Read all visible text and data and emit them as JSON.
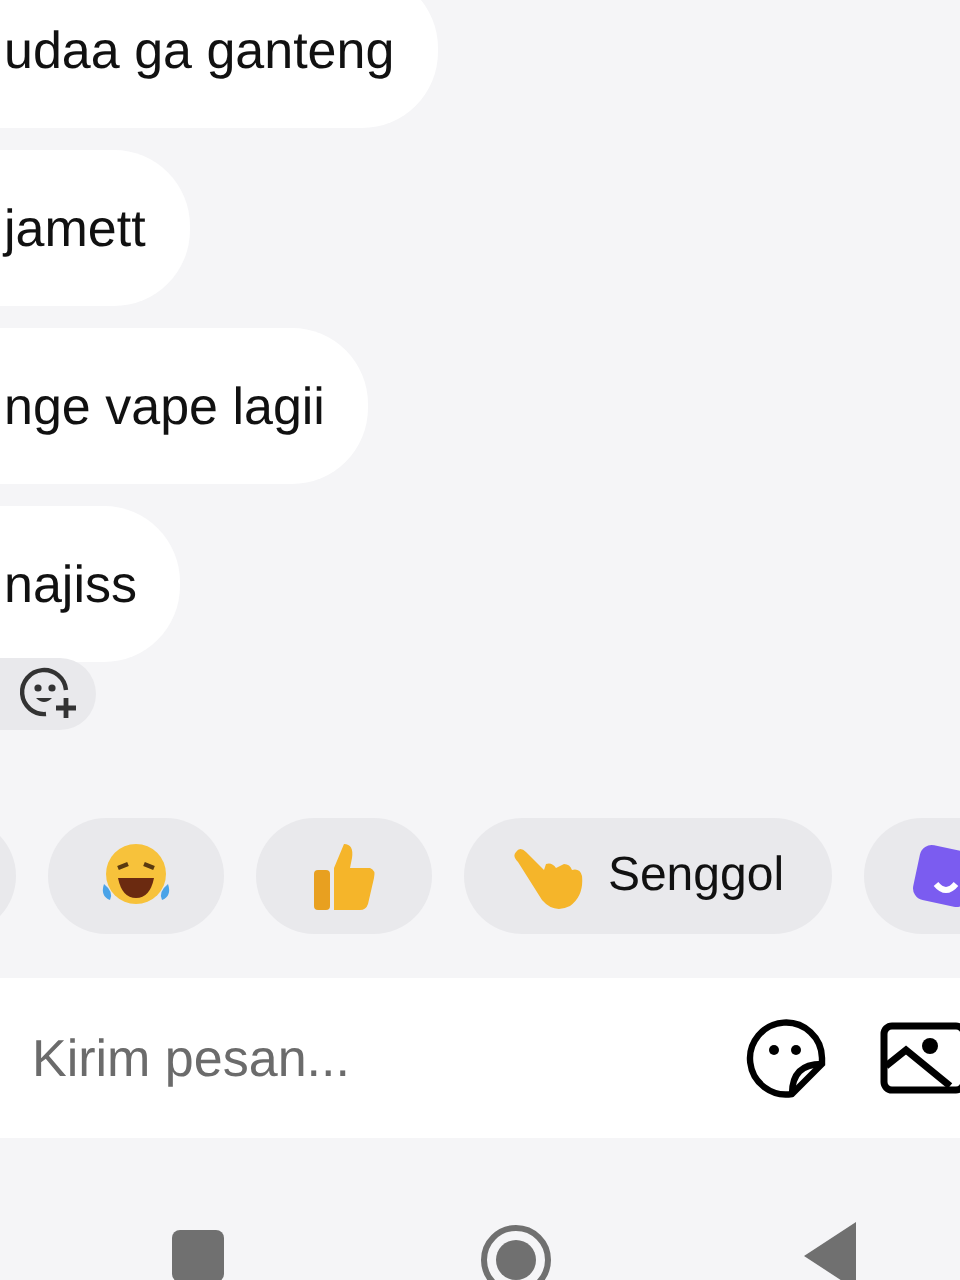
{
  "messages": [
    {
      "text": "udaa ga ganteng"
    },
    {
      "text": "jamett"
    },
    {
      "text": "nge vape lagii"
    },
    {
      "text": "najiss"
    }
  ],
  "quick_replies": [
    {
      "kind": "blank"
    },
    {
      "kind": "laugh"
    },
    {
      "kind": "thumbs"
    },
    {
      "kind": "wave",
      "label": "Senggol"
    },
    {
      "kind": "app"
    }
  ],
  "composer": {
    "placeholder": "Kirim pesan..."
  }
}
